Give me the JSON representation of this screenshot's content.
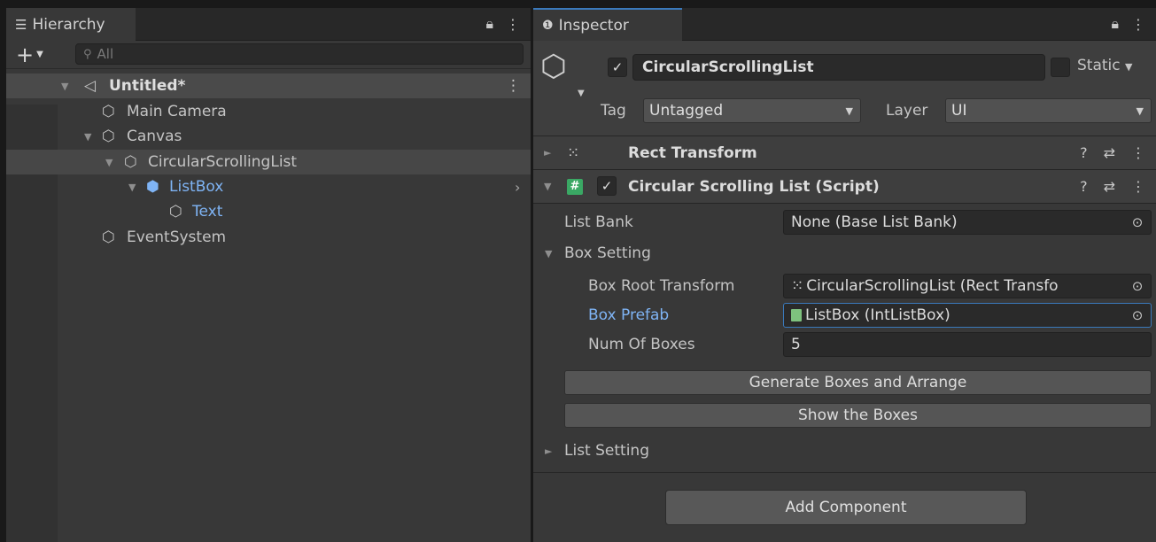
{
  "hierarchy": {
    "tab_title": "Hierarchy",
    "add_label": "+",
    "search_placeholder": "All",
    "scene_name": "Untitled*",
    "items": [
      {
        "label": "Main Camera"
      },
      {
        "label": "Canvas"
      },
      {
        "label": "CircularScrollingList"
      },
      {
        "label": "ListBox"
      },
      {
        "label": "Text"
      },
      {
        "label": "EventSystem"
      }
    ]
  },
  "inspector": {
    "tab_title": "Inspector",
    "object_name": "CircularScrollingList",
    "static_label": "Static",
    "tag_label": "Tag",
    "tag_value": "Untagged",
    "layer_label": "Layer",
    "layer_value": "UI",
    "components": [
      {
        "title": "Rect Transform"
      },
      {
        "title": "Circular Scrolling List (Script)"
      }
    ],
    "properties": {
      "list_bank_label": "List Bank",
      "list_bank_value": "None (Base List Bank)",
      "box_setting_label": "Box Setting",
      "box_root_transform_label": "Box Root Transform",
      "box_root_transform_value": "CircularScrollingList (Rect Transfo",
      "box_prefab_label": "Box Prefab",
      "box_prefab_value": "ListBox (IntListBox)",
      "num_of_boxes_label": "Num Of Boxes",
      "num_of_boxes_value": "5",
      "generate_button": "Generate Boxes and Arrange",
      "show_button": "Show the Boxes",
      "list_setting_label": "List Setting"
    },
    "add_component_label": "Add Component"
  },
  "colors": {
    "selection_blue": "#7fb4f5",
    "tab_accent": "#3a79bb",
    "script_icon": "#3aa864"
  }
}
